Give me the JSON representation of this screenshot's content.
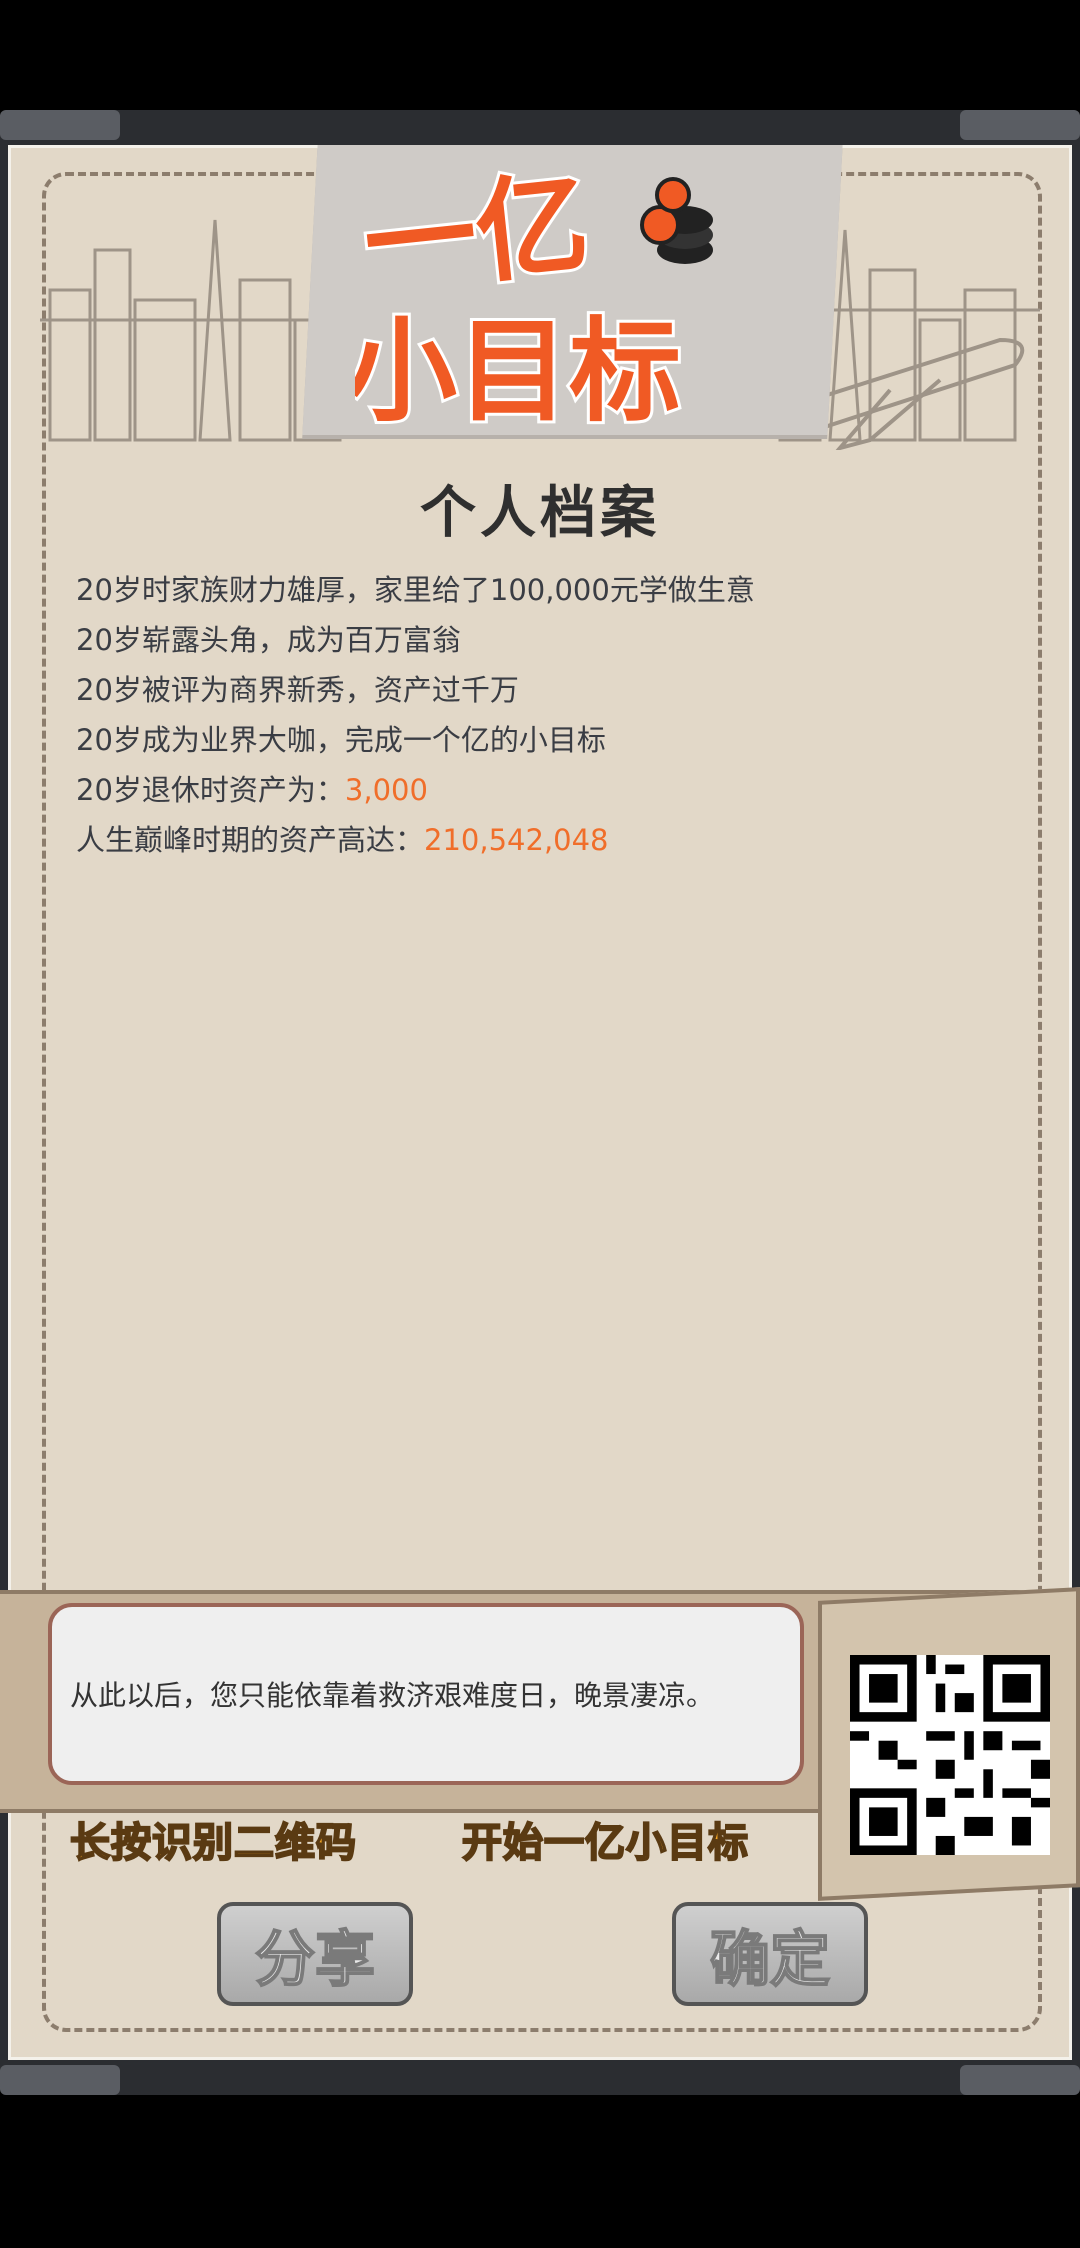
{
  "logo": {
    "line1": "一亿",
    "line2": "小目标"
  },
  "title": "个人档案",
  "records": [
    {
      "text": "20岁时家族财力雄厚，家里给了100,000元学做生意",
      "value": ""
    },
    {
      "text": "20岁崭露头角，成为百万富翁",
      "value": ""
    },
    {
      "text": "20岁被评为商界新秀，资产过千万",
      "value": ""
    },
    {
      "text": "20岁成为业界大咖，完成一个亿的小目标",
      "value": ""
    },
    {
      "text": "20岁退休时资产为：",
      "value": "3,000"
    },
    {
      "text": "人生巅峰时期的资产高达：",
      "value": "210,542,048"
    }
  ],
  "message": "从此以后，您只能依靠着救济艰难度日，晚景凄凉。",
  "qr_hint": "长按识别二维码",
  "start_text": "开始一亿小目标",
  "buttons": {
    "share": "分享",
    "confirm": "确定"
  },
  "colors": {
    "highlight": "#f06e2a",
    "logo": "#f05a24",
    "cta": "#f5a623"
  },
  "icons": [
    "coin-stack-icon",
    "qr-code-icon",
    "city-skyline-illustration",
    "airplane-illustration"
  ]
}
